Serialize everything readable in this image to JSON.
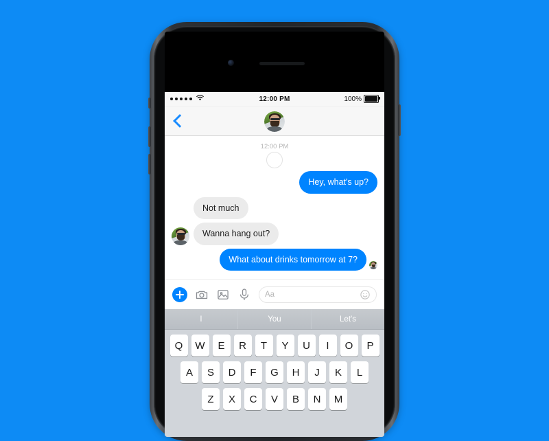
{
  "background": {
    "color": "#0d8bf5"
  },
  "device": {
    "name": "smartphone",
    "frame_color": "#2a2d31",
    "buttons": [
      "silent-switch",
      "volume-up",
      "volume-down",
      "power"
    ]
  },
  "status_bar": {
    "signal_dots": 5,
    "wifi_icon": "wifi-icon",
    "time": "12:00 PM",
    "battery_percent": "100%",
    "battery_level": 100
  },
  "nav_bar": {
    "back_icon": "back-chevron-icon",
    "avatar": "contact-avatar"
  },
  "thread": {
    "timestamp": "12:00 PM",
    "pending_indicator": "sending-circle",
    "messages": [
      {
        "side": "out",
        "text": "Hey, what's up?",
        "color": "#0084ff",
        "text_color": "#ffffff"
      },
      {
        "side": "in",
        "text": "Not much",
        "color": "#ebebeb",
        "text_color": "#1d1d1d"
      },
      {
        "side": "in",
        "text": "Wanna hang out?",
        "color": "#ebebeb",
        "text_color": "#1d1d1d",
        "avatar": true
      },
      {
        "side": "out",
        "text": "What about drinks tomorrow at 7?",
        "color": "#0084ff",
        "text_color": "#ffffff",
        "receipt": true
      }
    ]
  },
  "composer": {
    "add_label": "+",
    "icons": [
      "add-icon",
      "camera-icon",
      "photo-icon",
      "microphone-icon"
    ],
    "input_placeholder": "Aa",
    "emoji_icon": "smiley-icon"
  },
  "keyboard": {
    "suggestions": [
      "I",
      "You",
      "Let's"
    ],
    "row1": [
      "Q",
      "W",
      "E",
      "R",
      "T",
      "Y",
      "U",
      "I",
      "O",
      "P"
    ],
    "row2": [
      "A",
      "S",
      "D",
      "F",
      "G",
      "H",
      "J",
      "K",
      "L"
    ]
  }
}
